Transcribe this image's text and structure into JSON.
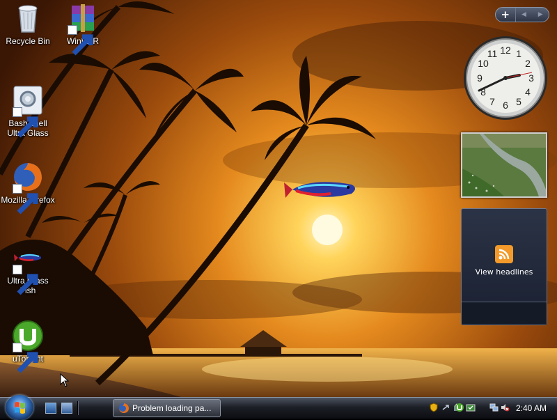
{
  "desktop": {
    "icons": [
      {
        "label_line1": "Recycle Bin",
        "label_line2": "",
        "icon": "recycle-bin-icon"
      },
      {
        "label_line1": "WinRAR",
        "label_line2": "",
        "icon": "winrar-icon"
      },
      {
        "label_line1": "Bash shell",
        "label_line2": "Ultra Glass",
        "icon": "bash-shell-icon"
      },
      {
        "label_line1": "Mozilla Firefox",
        "label_line2": "",
        "icon": "firefox-icon"
      },
      {
        "label_line1": "Ultra Glass",
        "label_line2": "Fish",
        "icon": "fish-icon"
      },
      {
        "label_line1": "uTorrent",
        "label_line2": "",
        "icon": "utorrent-icon"
      }
    ],
    "wallpaper": "tropical-sunset-palms"
  },
  "sidebar": {
    "add_symbol": "+",
    "prev_symbol": "◀",
    "next_symbol": "▶",
    "clock_numerals": [
      "12",
      "1",
      "2",
      "3",
      "4",
      "5",
      "6",
      "7",
      "8",
      "9",
      "10",
      "11"
    ],
    "feed_label": "View headlines"
  },
  "taskbar": {
    "task_title": "Problem loading pa...",
    "clock": "2:40 AM"
  },
  "colors": {
    "sunset_orange": "#d9781c",
    "taskbar_dark": "#0c0d12",
    "rss_orange": "#f39a2a"
  }
}
